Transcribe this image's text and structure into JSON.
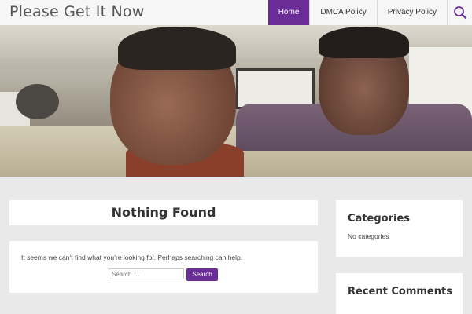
{
  "header": {
    "site_title": "Please Get It Now",
    "nav": [
      {
        "label": "Home",
        "active": true
      },
      {
        "label": "DMCA Policy",
        "active": false
      },
      {
        "label": "Privacy Policy",
        "active": false
      }
    ],
    "search_icon": "search-icon"
  },
  "main": {
    "page_title": "Nothing Found",
    "message": "It seems we can’t find what you’re looking for. Perhaps searching can help.",
    "search": {
      "placeholder": "Search …",
      "button_label": "Search"
    }
  },
  "sidebar": {
    "categories_title": "Categories",
    "categories_empty": "No categories",
    "recent_comments_title": "Recent Comments"
  },
  "colors": {
    "accent": "#6a2c96",
    "background": "#e9e9e9",
    "panel": "#ffffff"
  }
}
